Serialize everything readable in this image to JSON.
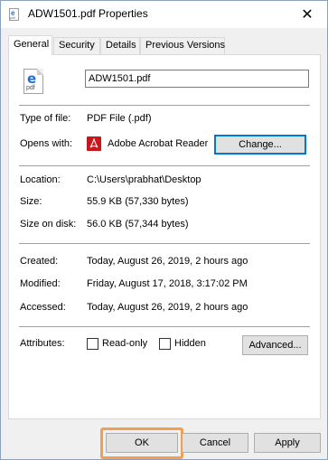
{
  "window": {
    "title": "ADW1501.pdf Properties",
    "close_glyph": "✕",
    "icon": "pdf-file-icon"
  },
  "tabs": [
    {
      "label": "General",
      "active": true
    },
    {
      "label": "Security",
      "active": false
    },
    {
      "label": "Details",
      "active": false
    },
    {
      "label": "Previous Versions",
      "active": false
    }
  ],
  "file": {
    "name": "ADW1501.pdf",
    "icon_letter": "e",
    "icon_caption": "pdf"
  },
  "type": {
    "label": "Type of file:",
    "value": "PDF File (.pdf)"
  },
  "opens_with": {
    "label": "Opens with:",
    "value": "Adobe Acrobat Reader",
    "change_button": "Change..."
  },
  "location": {
    "label": "Location:",
    "value": "C:\\Users\\prabhat\\Desktop"
  },
  "size": {
    "label": "Size:",
    "value": "55.9 KB (57,330 bytes)"
  },
  "size_on_disk": {
    "label": "Size on disk:",
    "value": "56.0 KB (57,344 bytes)"
  },
  "created": {
    "label": "Created:",
    "value": "Today, August 26, 2019, 2 hours ago"
  },
  "modified": {
    "label": "Modified:",
    "value": "Friday, August 17, 2018, 3:17:02 PM"
  },
  "accessed": {
    "label": "Accessed:",
    "value": "Today, August 26, 2019, 2 hours ago"
  },
  "attributes": {
    "label": "Attributes:",
    "readonly_label": "Read-only",
    "readonly_checked": false,
    "hidden_label": "Hidden",
    "hidden_checked": false,
    "advanced_button": "Advanced..."
  },
  "footer": {
    "ok": "OK",
    "cancel": "Cancel",
    "apply": "Apply"
  },
  "colors": {
    "accent": "#0078d7",
    "highlight": "#f0a050",
    "pdf_red": "#c8161d"
  }
}
